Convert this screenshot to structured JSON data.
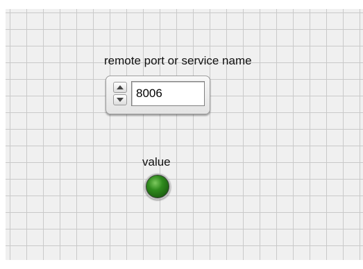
{
  "controls": {
    "port_label": "remote port or service name",
    "port_value": "8006"
  },
  "indicators": {
    "value_label": "value",
    "led_state": "on",
    "led_color": "#2f8a1d"
  },
  "panel": {
    "background_color": "#f0f0f0",
    "grid_color": "#c9c9c9"
  }
}
